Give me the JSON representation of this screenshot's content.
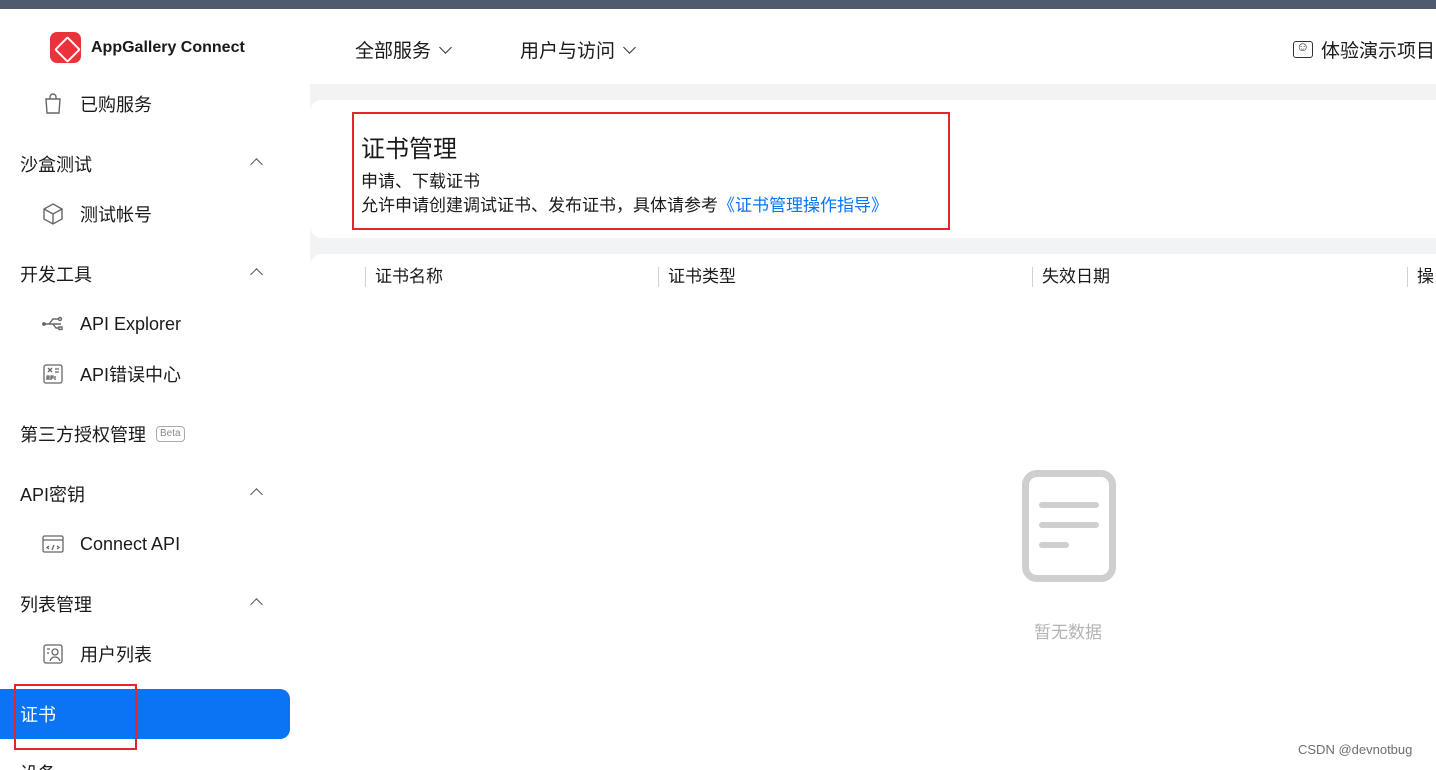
{
  "header": {
    "app_name": "AppGallery Connect",
    "nav": [
      "全部服务",
      "用户与访问"
    ],
    "demo_label": "体验演示项目"
  },
  "sidebar": {
    "purchased": "已购服务",
    "sandbox_group": "沙盒测试",
    "test_account": "测试帐号",
    "devtools_group": "开发工具",
    "api_explorer": "API Explorer",
    "api_error_center": "API错误中心",
    "third_party_auth": "第三方授权管理",
    "beta_badge": "Beta",
    "api_key_group": "API密钥",
    "connect_api": "Connect API",
    "list_mgmt_group": "列表管理",
    "user_list": "用户列表",
    "certificate": "证书",
    "next_item_partial": "设备"
  },
  "page": {
    "title": "证书管理",
    "subtitle": "申请、下载证书",
    "description": "允许申请创建调试证书、发布证书，具体请参考",
    "guide_link": "《证书管理操作指导》"
  },
  "table": {
    "columns": [
      "证书名称",
      "证书类型",
      "失效日期",
      "操"
    ],
    "empty_text": "暂无数据"
  },
  "watermark": "CSDN @devnotbug",
  "colors": {
    "accent": "#0a74f5",
    "highlight_box": "#e5252d",
    "brand": "#e8333a"
  }
}
